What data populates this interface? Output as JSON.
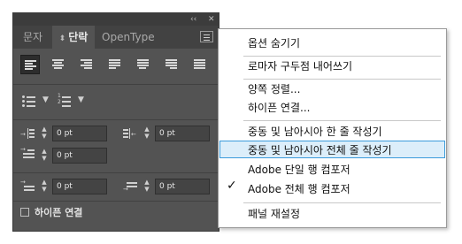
{
  "panel": {
    "controls": {
      "collapse": "‹‹",
      "close": "✕"
    },
    "tabs": [
      {
        "label": "문자"
      },
      {
        "label": "단락",
        "prefix": "⬍"
      },
      {
        "label": "OpenType"
      }
    ],
    "fields": {
      "left_indent": "0 pt",
      "right_indent": "0 pt",
      "first_line_indent": "0 pt",
      "space_before": "0 pt",
      "space_after": "0 pt"
    },
    "hyphenate_label": "하이픈 연결"
  },
  "menu": {
    "items": [
      {
        "label": "옵션 숨기기"
      },
      {
        "label": "로마자 구두점 내어쓰기"
      },
      {
        "label": "양쪽 정렬..."
      },
      {
        "label": "하이픈 연결..."
      },
      {
        "label": "중동 및 남아시아 한 줄 작성기"
      },
      {
        "label": "중동 및 남아시아 전체 줄 작성기"
      },
      {
        "label": "Adobe 단일 행 컴포저"
      },
      {
        "label": "Adobe 전체 행 컴포저"
      },
      {
        "label": "패널 재설정"
      }
    ],
    "checkmark": "✓"
  }
}
